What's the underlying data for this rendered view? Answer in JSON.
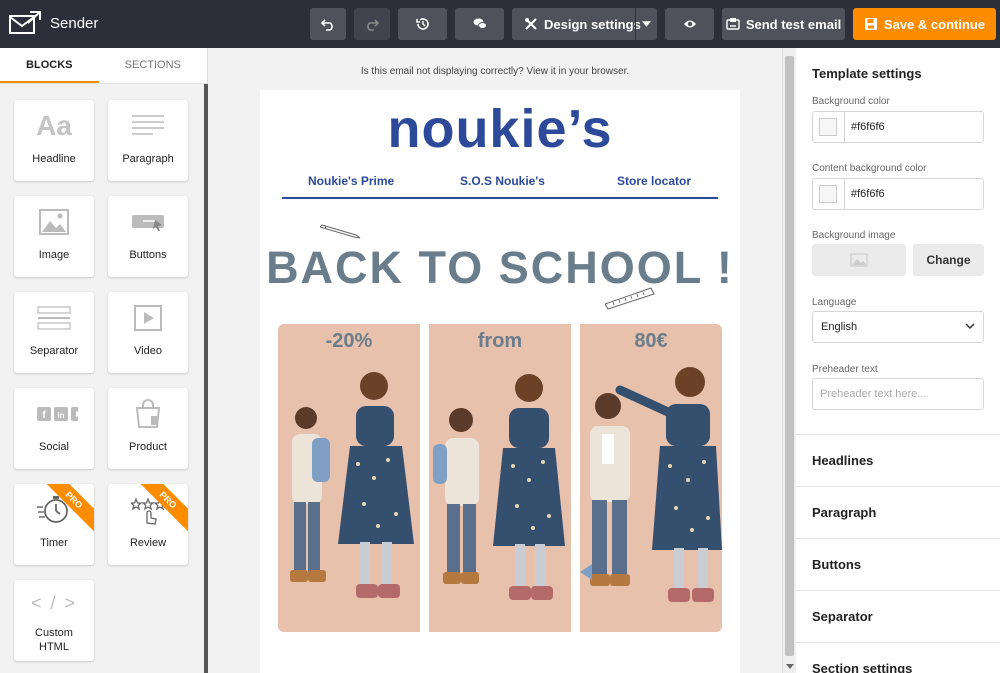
{
  "app": {
    "name": "Sender"
  },
  "toolbar": {
    "design_settings": "Design settings",
    "send_test": "Send test email",
    "save": "Save & continue"
  },
  "left": {
    "tabs": [
      "BLOCKS",
      "SECTIONS"
    ],
    "blocks": [
      {
        "label": "Headline",
        "icon": "headline-icon"
      },
      {
        "label": "Paragraph",
        "icon": "paragraph-icon"
      },
      {
        "label": "Image",
        "icon": "image-icon"
      },
      {
        "label": "Buttons",
        "icon": "buttons-icon"
      },
      {
        "label": "Separator",
        "icon": "separator-icon"
      },
      {
        "label": "Video",
        "icon": "video-icon"
      },
      {
        "label": "Social",
        "icon": "social-icon"
      },
      {
        "label": "Product",
        "icon": "product-icon"
      },
      {
        "label": "Timer",
        "icon": "timer-icon",
        "badge": "PRO"
      },
      {
        "label": "Review",
        "icon": "review-icon",
        "badge": "PRO"
      },
      {
        "label": "Custom HTML",
        "icon": "code-icon"
      }
    ],
    "headline_glyph": "Aa",
    "code_glyph": "< / >"
  },
  "canvas": {
    "notice": "Is this email not displaying correctly? View it in your browser.",
    "brand": "noukie’s",
    "nav": [
      "Noukie's Prime",
      "S.O.S Noukie's",
      "Store locator"
    ],
    "headline": "BACK TO SCHOOL !",
    "photos": [
      "-20%",
      "from",
      "80€"
    ]
  },
  "right": {
    "title": "Template settings",
    "bg_color_label": "Background color",
    "bg_color_value": "#f6f6f6",
    "content_bg_label": "Content background color",
    "content_bg_value": "#f6f6f6",
    "bg_image_label": "Background image",
    "change": "Change",
    "language_label": "Language",
    "language_value": "English",
    "preheader_label": "Preheader text",
    "preheader_placeholder": "Preheader text here...",
    "sections": [
      "Headlines",
      "Paragraph",
      "Buttons",
      "Separator",
      "Section settings"
    ]
  },
  "colors": {
    "accent": "#fd8c00",
    "brand_blue": "#2d4a9a",
    "topbar": "#2c2f3a"
  }
}
